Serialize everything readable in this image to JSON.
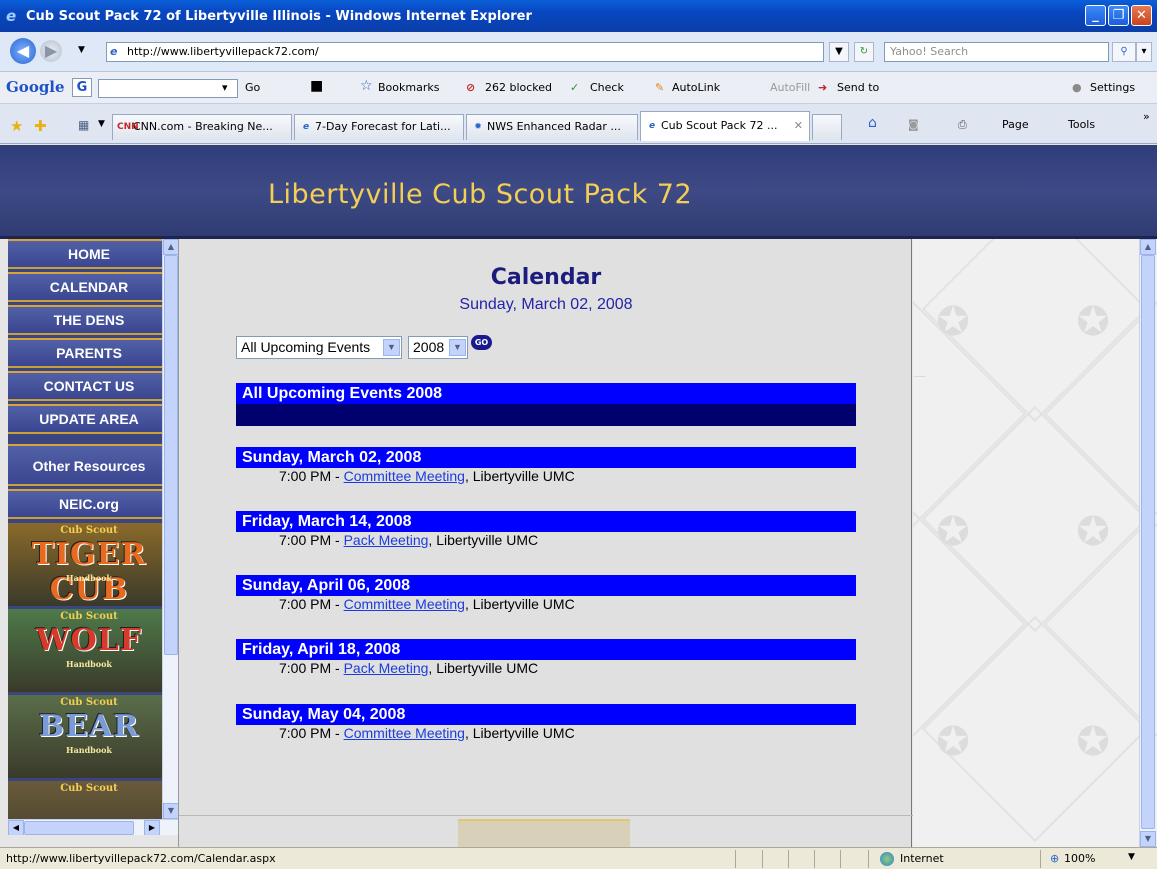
{
  "window": {
    "title": "Cub Scout Pack 72 of Libertyville Illinois - Windows Internet Explorer",
    "minimize": "_",
    "restore": "❐",
    "close": "✕"
  },
  "addressbar": {
    "url": "http://www.libertyvillepack72.com/",
    "search_placeholder": "Yahoo! Search"
  },
  "google_toolbar": {
    "logo": "Google",
    "go": "Go",
    "bookmarks": "Bookmarks",
    "blocked": "262 blocked",
    "check": "Check",
    "autolink": "AutoLink",
    "autofill": "AutoFill",
    "sendto": "Send to",
    "settings": "Settings"
  },
  "tabs": [
    {
      "label": "CNN.com - Breaking Ne...",
      "icon": "CNN"
    },
    {
      "label": "7-Day Forecast for Lati...",
      "icon": "e"
    },
    {
      "label": "NWS Enhanced Radar ...",
      "icon": "✹"
    },
    {
      "label": "Cub Scout Pack 72 ...",
      "icon": "e"
    }
  ],
  "tab_tools": {
    "page": "Page",
    "tools": "Tools"
  },
  "site": {
    "banner_title": "Libertyville Cub Scout Pack 72",
    "nav": [
      "HOME",
      "CALENDAR",
      "THE DENS",
      "PARENTS",
      "CONTACT US",
      "UPDATE AREA"
    ],
    "other_resources": "Other Resources",
    "neic": "NEIC.org",
    "badges": [
      {
        "top": "Cub Scout",
        "name": "TIGER CUB",
        "sub": "Handbook",
        "color": "#e86a1e",
        "bg": "#8a6a2a"
      },
      {
        "top": "Cub Scout",
        "name": "WOLF",
        "sub": "Handbook",
        "color": "#d63a2a",
        "bg": "#4e7a4a"
      },
      {
        "top": "Cub Scout",
        "name": "BEAR",
        "sub": "Handbook",
        "color": "#7a9ad8",
        "bg": "#5a6e4a"
      },
      {
        "top": "Cub Scout",
        "name": "",
        "sub": "",
        "color": "#f4cf52",
        "bg": "#6a5a3a"
      }
    ]
  },
  "calendar": {
    "title": "Calendar",
    "date": "Sunday, March 02, 2008",
    "filter_value": "All Upcoming Events",
    "year_value": "2008",
    "go_label": "GO",
    "header": "All Upcoming Events 2008",
    "events": [
      {
        "date": "Sunday, March 02, 2008",
        "time": "7:00 PM - ",
        "name": "Committee Meeting",
        "location": ",  Libertyville UMC"
      },
      {
        "date": "Friday, March 14, 2008",
        "time": "7:00 PM - ",
        "name": "Pack Meeting",
        "location": ",  Libertyville UMC"
      },
      {
        "date": "Sunday, April 06, 2008",
        "time": "7:00 PM - ",
        "name": "Committee Meeting",
        "location": ",  Libertyville UMC"
      },
      {
        "date": "Friday, April 18, 2008",
        "time": "7:00 PM - ",
        "name": "Pack Meeting",
        "location": ",  Libertyville UMC"
      },
      {
        "date": "Sunday, May 04, 2008",
        "time": "7:00 PM - ",
        "name": "Committee Meeting",
        "location": ",  Libertyville UMC"
      }
    ]
  },
  "statusbar": {
    "url": "http://www.libertyvillepack72.com/Calendar.aspx",
    "zone": "Internet",
    "zoom": "100%"
  }
}
